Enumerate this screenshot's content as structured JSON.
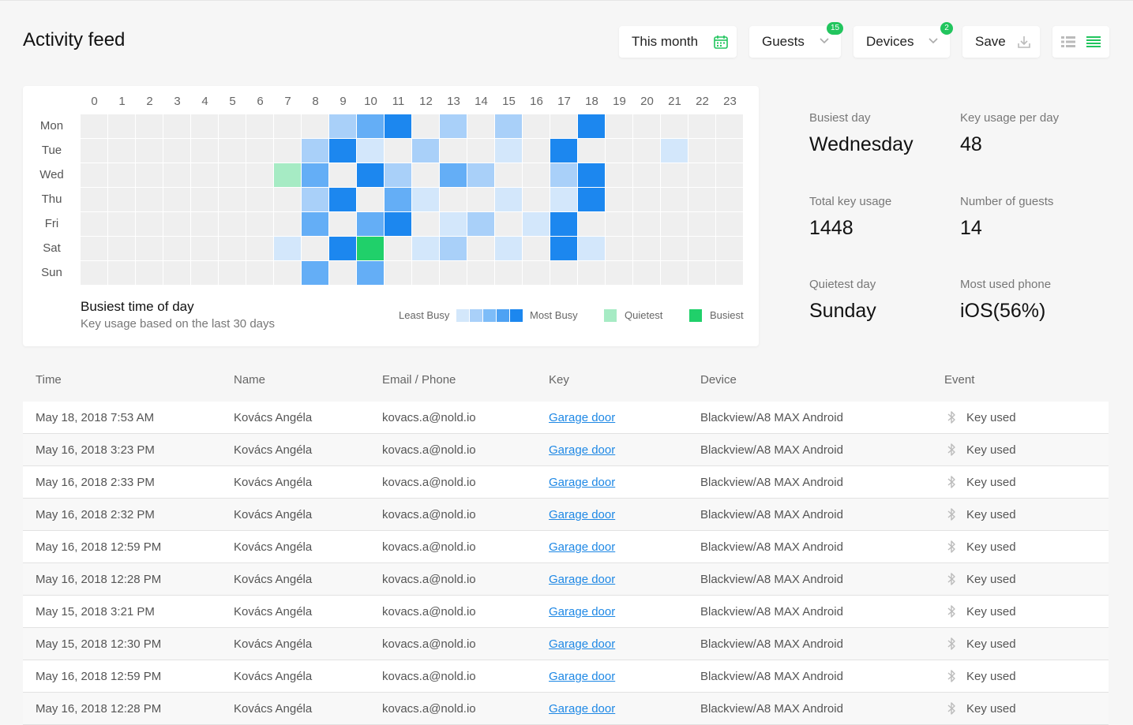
{
  "header": {
    "title": "Activity feed",
    "date_filter": "This month",
    "guests_label": "Guests",
    "guests_count": "15",
    "devices_label": "Devices",
    "devices_count": "2",
    "save_label": "Save"
  },
  "heatmap": {
    "hours": [
      "0",
      "1",
      "2",
      "3",
      "4",
      "5",
      "6",
      "7",
      "8",
      "9",
      "10",
      "11",
      "12",
      "13",
      "14",
      "15",
      "16",
      "17",
      "18",
      "19",
      "20",
      "21",
      "22",
      "23"
    ],
    "days": [
      "Mon",
      "Tue",
      "Wed",
      "Thu",
      "Fri",
      "Sat",
      "Sun"
    ],
    "levels": [
      [
        0,
        0,
        0,
        0,
        0,
        0,
        0,
        0,
        0,
        2,
        3,
        4,
        0,
        2,
        0,
        2,
        0,
        0,
        4,
        0,
        0,
        0,
        0,
        0
      ],
      [
        0,
        0,
        0,
        0,
        0,
        0,
        0,
        0,
        2,
        4,
        1,
        0,
        2,
        0,
        0,
        1,
        0,
        4,
        0,
        0,
        0,
        1,
        0,
        0
      ],
      [
        0,
        0,
        0,
        0,
        0,
        0,
        0,
        5,
        3,
        0,
        4,
        2,
        0,
        3,
        2,
        0,
        0,
        2,
        4,
        0,
        0,
        0,
        0,
        0
      ],
      [
        0,
        0,
        0,
        0,
        0,
        0,
        0,
        0,
        2,
        4,
        0,
        3,
        1,
        0,
        0,
        1,
        0,
        1,
        4,
        0,
        0,
        0,
        0,
        0
      ],
      [
        0,
        0,
        0,
        0,
        0,
        0,
        0,
        0,
        3,
        0,
        3,
        4,
        0,
        1,
        2,
        0,
        1,
        4,
        0,
        0,
        0,
        0,
        0,
        0
      ],
      [
        0,
        0,
        0,
        0,
        0,
        0,
        0,
        1,
        0,
        4,
        6,
        0,
        1,
        2,
        0,
        1,
        0,
        4,
        1,
        0,
        0,
        0,
        0,
        0
      ],
      [
        0,
        0,
        0,
        0,
        0,
        0,
        0,
        0,
        3,
        0,
        3,
        0,
        0,
        0,
        0,
        0,
        0,
        0,
        0,
        0,
        0,
        0,
        0,
        0
      ]
    ],
    "colors": {
      "empty": "#efefef",
      "scale": [
        "#d3e7fb",
        "#a9d0f9",
        "#64aef6",
        "#1c87ef"
      ],
      "quietest": "#a6ebc4",
      "busiest": "#20d06a"
    },
    "caption_title": "Busiest time of day",
    "caption_sub": "Key usage based on the last 30 days",
    "legend": {
      "least": "Least Busy",
      "most": "Most Busy",
      "quietest": "Quietest",
      "busiest": "Busiest"
    }
  },
  "stats": {
    "busiest_day_label": "Busiest day",
    "busiest_day_value": "Wednesday",
    "per_day_label": "Key usage per day",
    "per_day_value": "48",
    "total_label": "Total key usage",
    "total_value": "1448",
    "guests_label": "Number of guests",
    "guests_value": "14",
    "quietest_label": "Quietest day",
    "quietest_value": "Sunday",
    "phone_label": "Most used phone",
    "phone_value": "iOS(56%)"
  },
  "table": {
    "columns": [
      "Time",
      "Name",
      "Email / Phone",
      "Key",
      "Device",
      "Event"
    ],
    "rows": [
      {
        "time": "May 18, 2018 7:53 AM",
        "name": "Kovács Angéla",
        "email": "kovacs.a@nold.io",
        "key": "Garage door",
        "device": "Blackview/A8 MAX Android",
        "event": "Key used"
      },
      {
        "time": "May 16, 2018 3:23 PM",
        "name": "Kovács Angéla",
        "email": "kovacs.a@nold.io",
        "key": "Garage door",
        "device": "Blackview/A8 MAX Android",
        "event": "Key used"
      },
      {
        "time": "May 16, 2018 2:33 PM",
        "name": "Kovács Angéla",
        "email": "kovacs.a@nold.io",
        "key": "Garage door",
        "device": "Blackview/A8 MAX Android",
        "event": "Key used"
      },
      {
        "time": "May 16, 2018 2:32 PM",
        "name": "Kovács Angéla",
        "email": "kovacs.a@nold.io",
        "key": "Garage door",
        "device": "Blackview/A8 MAX Android",
        "event": "Key used"
      },
      {
        "time": "May 16, 2018 12:59 PM",
        "name": "Kovács Angéla",
        "email": "kovacs.a@nold.io",
        "key": "Garage door",
        "device": "Blackview/A8 MAX Android",
        "event": "Key used"
      },
      {
        "time": "May 16, 2018 12:28 PM",
        "name": "Kovács Angéla",
        "email": "kovacs.a@nold.io",
        "key": "Garage door",
        "device": "Blackview/A8 MAX Android",
        "event": "Key used"
      },
      {
        "time": "May 15, 2018 3:21 PM",
        "name": "Kovács Angéla",
        "email": "kovacs.a@nold.io",
        "key": "Garage door",
        "device": "Blackview/A8 MAX Android",
        "event": "Key used"
      },
      {
        "time": "May 15, 2018 12:30 PM",
        "name": "Kovács Angéla",
        "email": "kovacs.a@nold.io",
        "key": "Garage door",
        "device": "Blackview/A8 MAX Android",
        "event": "Key used"
      },
      {
        "time": "May 16, 2018 12:59 PM",
        "name": "Kovács Angéla",
        "email": "kovacs.a@nold.io",
        "key": "Garage door",
        "device": "Blackview/A8 MAX Android",
        "event": "Key used"
      },
      {
        "time": "May 16, 2018 12:28 PM",
        "name": "Kovács Angéla",
        "email": "kovacs.a@nold.io",
        "key": "Garage door",
        "device": "Blackview/A8 MAX Android",
        "event": "Key used"
      }
    ]
  }
}
